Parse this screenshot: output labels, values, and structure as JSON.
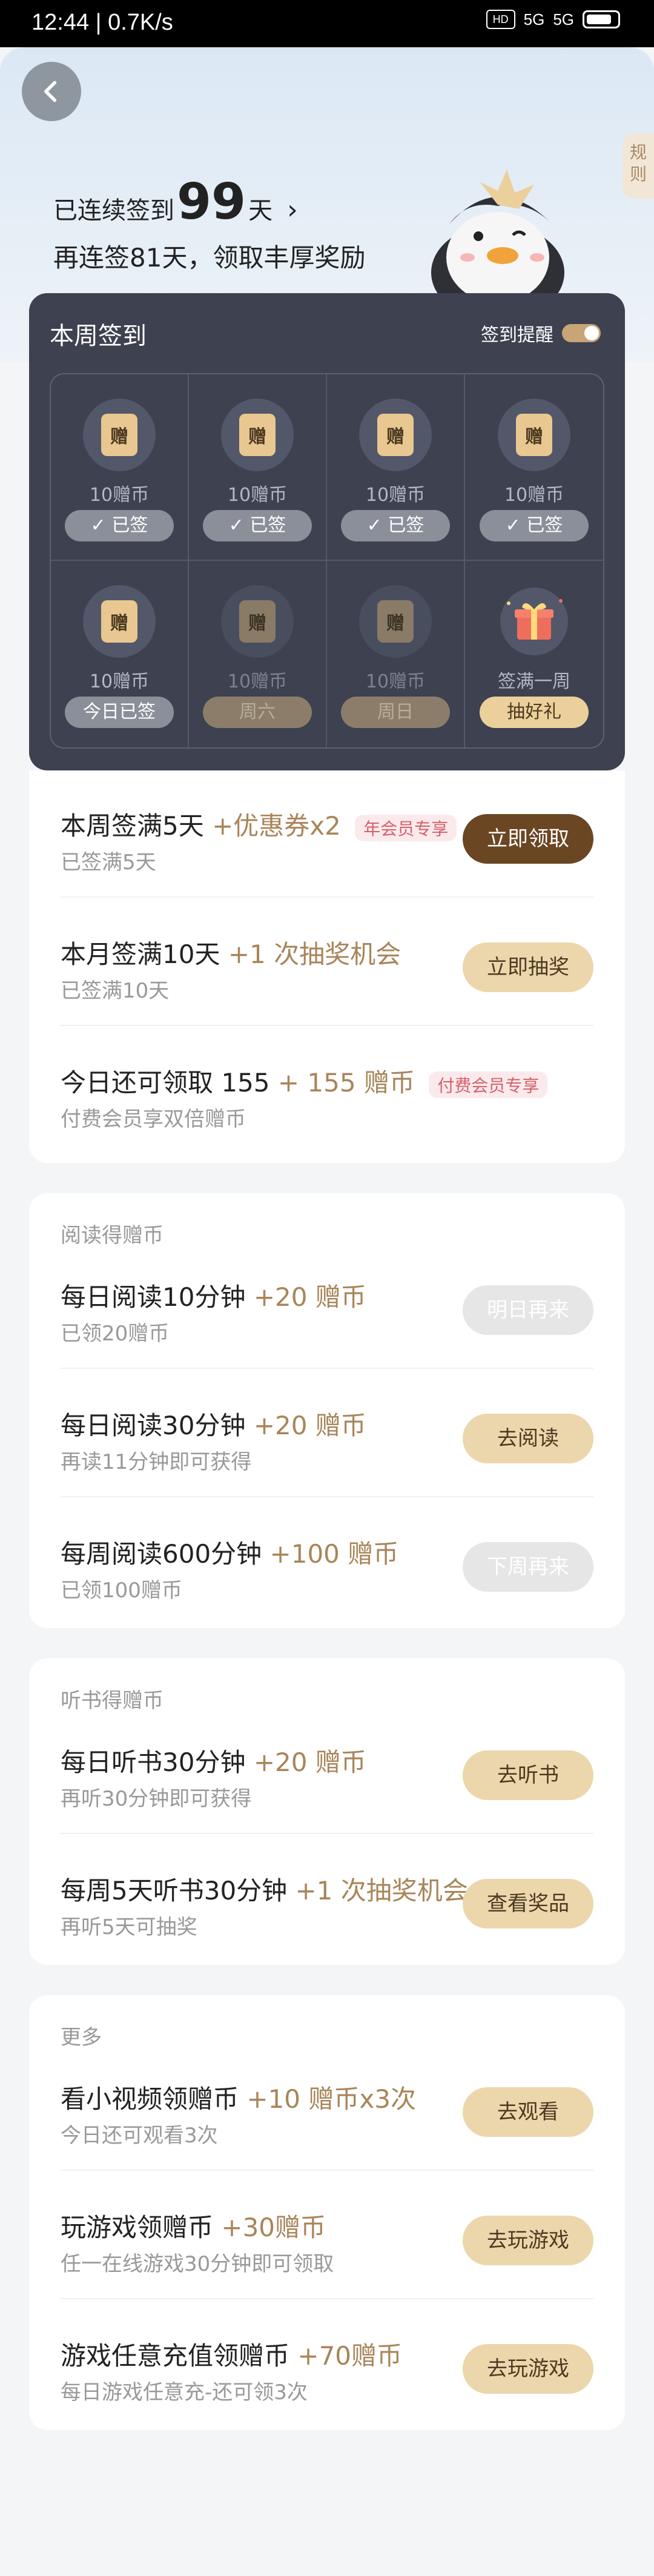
{
  "status_bar": {
    "time": "12:44 | 0.7K/s",
    "hd": "HD",
    "signal1": "5G",
    "signal2": "5G"
  },
  "header": {
    "rules_label": "规则",
    "streak_prefix": "已连续签到",
    "streak_days": "99",
    "streak_suffix": "天",
    "hint": "再连签81天，领取丰厚奖励"
  },
  "week": {
    "title": "本周签到",
    "reminder_label": "签到提醒",
    "reminder_on": true,
    "days": [
      {
        "coin_label": "赠",
        "amount": "10赠币",
        "status": "已签",
        "state": "signed"
      },
      {
        "coin_label": "赠",
        "amount": "10赠币",
        "status": "已签",
        "state": "signed"
      },
      {
        "coin_label": "赠",
        "amount": "10赠币",
        "status": "已签",
        "state": "signed"
      },
      {
        "coin_label": "赠",
        "amount": "10赠币",
        "status": "已签",
        "state": "signed"
      },
      {
        "coin_label": "赠",
        "amount": "10赠币",
        "status": "今日已签",
        "state": "today"
      },
      {
        "coin_label": "赠",
        "amount": "10赠币",
        "status": "周六",
        "state": "future"
      },
      {
        "coin_label": "赠",
        "amount": "10赠币",
        "status": "周日",
        "state": "future"
      },
      {
        "coin_label": "",
        "amount": "签满一周",
        "status": "抽好礼",
        "state": "gift"
      }
    ]
  },
  "tasks_main": [
    {
      "title": "本周签满5天",
      "reward": "+优惠券x2",
      "tag": "年会员专享",
      "sub": "已签满5天",
      "button": "立即领取",
      "btn_style": "dark"
    },
    {
      "title": "本月签满10天",
      "reward": "+1 次抽奖机会",
      "tag": "",
      "sub": "已签满10天",
      "button": "立即抽奖",
      "btn_style": "gold"
    },
    {
      "title": "今日还可领取 155",
      "reward": "+ 155 赠币",
      "tag": "付费会员专享",
      "sub": "付费会员享双倍赠币",
      "button": "",
      "btn_style": ""
    }
  ],
  "reading": {
    "section": "阅读得赠币",
    "items": [
      {
        "title": "每日阅读10分钟",
        "reward": "+20 赠币",
        "sub": "已领20赠币",
        "button": "明日再来",
        "btn_style": "gray"
      },
      {
        "title": "每日阅读30分钟",
        "reward": "+20 赠币",
        "sub": "再读11分钟即可获得",
        "button": "去阅读",
        "btn_style": "gold"
      },
      {
        "title": "每周阅读600分钟",
        "reward": "+100 赠币",
        "sub": "已领100赠币",
        "button": "下周再来",
        "btn_style": "gray"
      }
    ]
  },
  "listening": {
    "section": "听书得赠币",
    "items": [
      {
        "title": "每日听书30分钟",
        "reward": "+20 赠币",
        "sub": "再听30分钟即可获得",
        "button": "去听书",
        "btn_style": "gold"
      },
      {
        "title": "每周5天听书30分钟",
        "reward": "+1 次抽奖机会",
        "sub": "再听5天可抽奖",
        "button": "查看奖品",
        "btn_style": "gold"
      }
    ]
  },
  "more": {
    "section": "更多",
    "items": [
      {
        "title": "看小视频领赠币",
        "reward": "+10 赠币x3次",
        "sub": "今日还可观看3次",
        "button": "去观看",
        "btn_style": "gold"
      },
      {
        "title": "玩游戏领赠币",
        "reward": "+30赠币",
        "sub": "任一在线游戏30分钟即可领取",
        "button": "去玩游戏",
        "btn_style": "gold"
      },
      {
        "title": "游戏任意充值领赠币",
        "reward": "+70赠币",
        "sub": "每日游戏任意充-还可领3次",
        "button": "去玩游戏",
        "btn_style": "gold"
      }
    ]
  },
  "colors": {
    "accent_gold": "#a8855a",
    "dark_panel": "#3d4150",
    "primary_button": "#6b4623"
  }
}
